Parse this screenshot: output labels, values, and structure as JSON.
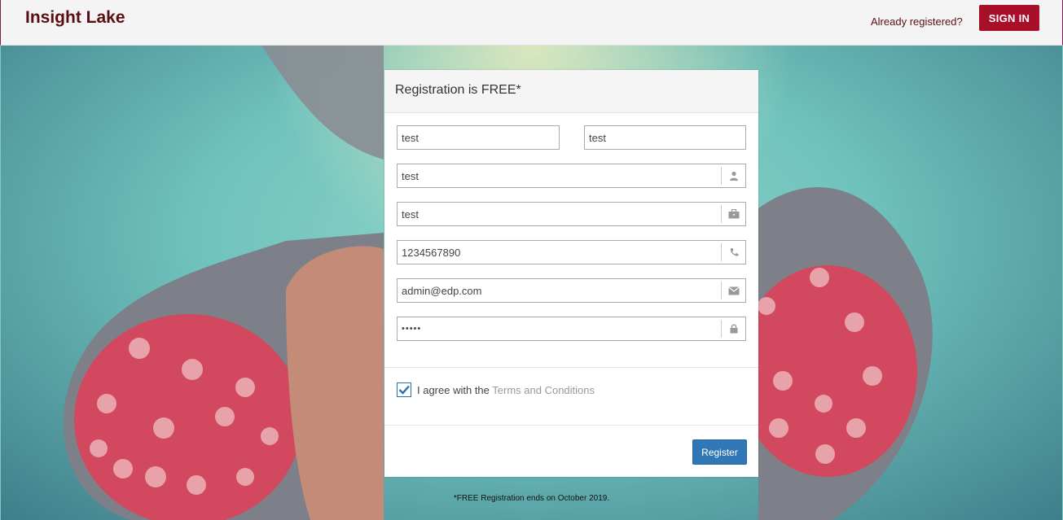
{
  "header": {
    "brand": "Insight Lake",
    "already_registered": "Already registered?",
    "sign_in_label": "SIGN IN"
  },
  "form": {
    "title": "Registration is FREE*",
    "first_name_value": "test",
    "last_name_value": "test",
    "username_value": "test",
    "company_value": "test",
    "phone_value": "1234567890",
    "email_value": "admin@edp.com",
    "password_value": "•••••",
    "agree_text": "I agree with the",
    "terms_link": "Terms and Conditions",
    "agree_checked": true,
    "register_label": "Register"
  },
  "footnote": "*FREE Registration ends on October 2019.",
  "icons": {
    "username": "user-icon",
    "company": "briefcase-icon",
    "phone": "phone-icon",
    "email": "envelope-icon",
    "password": "lock-icon"
  },
  "colors": {
    "brand": "#5a0e14",
    "sign_in_bg": "#a8102a",
    "register_bg": "#3277b5"
  }
}
